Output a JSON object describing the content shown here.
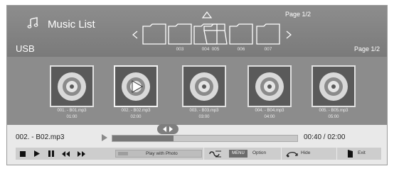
{
  "header": {
    "title": "Music List",
    "source": "USB",
    "page_top": "Page 1/2",
    "page_right": "Page 1/2"
  },
  "folders": [
    {
      "label": "",
      "open": false
    },
    {
      "label": "003",
      "open": false
    },
    {
      "label": "004",
      "open": false
    },
    {
      "label": "005",
      "open": true
    },
    {
      "label": "006",
      "open": false
    },
    {
      "label": "007",
      "open": false
    }
  ],
  "files": [
    {
      "name": "001. - B01.mp3",
      "duration": "01:00",
      "playing": false
    },
    {
      "name": "002. - B02.mp3",
      "duration": "02:00",
      "playing": true
    },
    {
      "name": "003. - B03.mp3",
      "duration": "03:00",
      "playing": false
    },
    {
      "name": "004. - B04.mp3",
      "duration": "04:00",
      "playing": false
    },
    {
      "name": "005. - B05.mp3",
      "duration": "05:00",
      "playing": false
    }
  ],
  "player": {
    "track": "002. - B02.mp3",
    "elapsed": "00:40",
    "total": "02:00",
    "time_display": "00:40 / 02:00",
    "progress": 0.33
  },
  "controls": {
    "play_with_photo": "Play with Photo",
    "menu_key": "MENU",
    "option": "Option",
    "hide": "Hide",
    "exit": "Exit"
  }
}
